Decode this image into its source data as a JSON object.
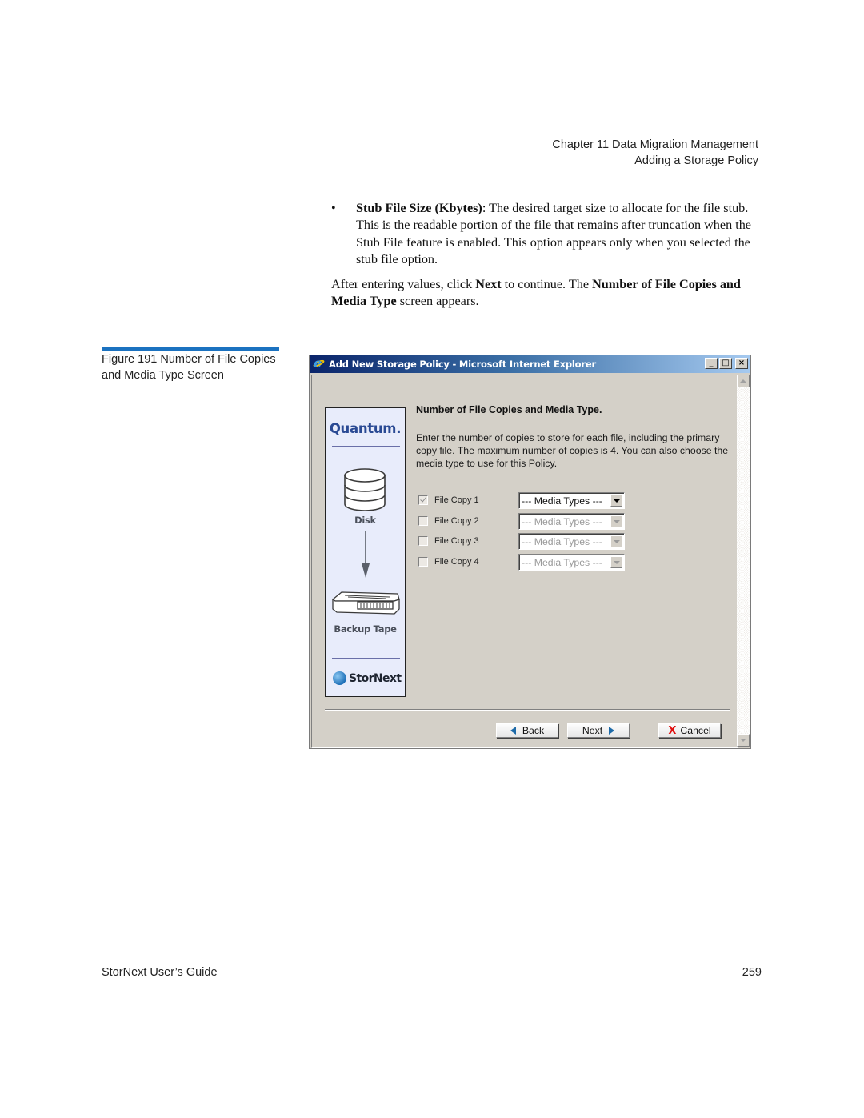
{
  "running_header": {
    "chapter": "Chapter 11  Data Migration Management",
    "section": "Adding a Storage Policy"
  },
  "body": {
    "bullet": {
      "symbol": "•",
      "term": "Stub File Size (Kbytes)",
      "text": ": The desired target size to allocate for the file stub. This is the readable portion of the file that remains after truncation when the Stub File feature is enabled. This option appears only when you selected the stub file option."
    },
    "paragraph": {
      "part1": "After entering values, click ",
      "bold1": "Next",
      "part2": " to continue. The ",
      "bold2": "Number of File Copies and Media Type",
      "part3": " screen appears."
    }
  },
  "figure": {
    "caption": "Figure 191  Number of File Copies and Media Type Screen"
  },
  "window": {
    "title": "Add New Storage Policy - Microsoft Internet Explorer",
    "controls": {
      "minimize": "_",
      "maximize": "□",
      "close": "×"
    },
    "sidebar": {
      "brand": "Quantum.",
      "source_label": "Disk",
      "target_label": "Backup Tape",
      "product": "StorNext"
    },
    "heading": "Number of File Copies and Media Type.",
    "description": "Enter the number of copies to store for each file, including the primary copy file. The maximum number of copies is 4. You can also choose the media type to use for this Policy.",
    "copies": [
      {
        "label": "File Copy 1",
        "checked": true,
        "media_type": "--- Media Types ---",
        "enabled": true
      },
      {
        "label": "File Copy 2",
        "checked": false,
        "media_type": "--- Media Types ---",
        "enabled": false
      },
      {
        "label": "File Copy 3",
        "checked": false,
        "media_type": "--- Media Types ---",
        "enabled": false
      },
      {
        "label": "File Copy 4",
        "checked": false,
        "media_type": "--- Media Types ---",
        "enabled": false
      }
    ],
    "buttons": {
      "back": "Back",
      "next": "Next",
      "cancel": "Cancel"
    },
    "colors": {
      "title_gradient_start": "#0a246a",
      "title_gradient_end": "#a6caf0",
      "sidebar_bg": "#e8ecfb",
      "brand": "#2a4a94",
      "cancel_icon": "#e01010",
      "nav_arrow": "#1d6aa8"
    }
  },
  "footer": {
    "guide": "StorNext User’s Guide",
    "page": "259"
  }
}
